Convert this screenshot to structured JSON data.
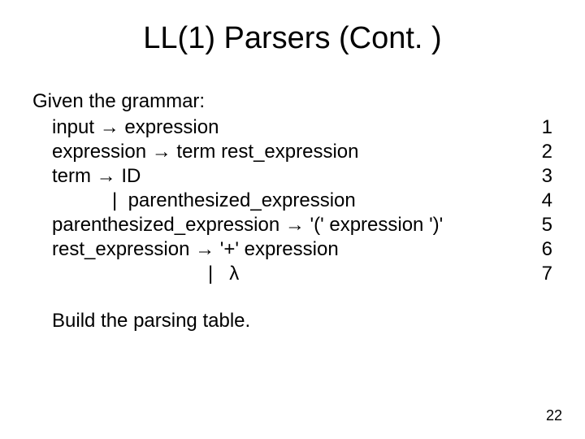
{
  "title": "LL(1) Parsers (Cont. )",
  "intro": "Given the grammar:",
  "rules": [
    {
      "text": "input → expression",
      "num": "1"
    },
    {
      "text": "expression → term rest_expression",
      "num": "2"
    },
    {
      "text": "term → ID",
      "num": "3"
    },
    {
      "text": "|  parenthesized_expression",
      "num": "4"
    },
    {
      "text": "parenthesized_expression → '(' expression ')'",
      "num": "5"
    },
    {
      "text": "rest_expression → '+' expression",
      "num": "6"
    },
    {
      "text": "|   λ",
      "num": "7"
    }
  ],
  "task": "Build the parsing table.",
  "page_number": "22"
}
